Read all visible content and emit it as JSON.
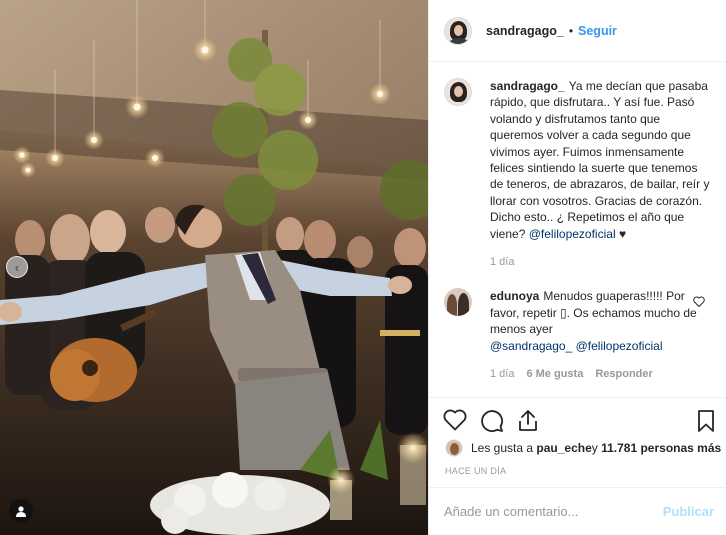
{
  "post": {
    "username": "sandragago_",
    "dot": "•",
    "follow_label": "Seguir"
  },
  "caption": {
    "username": "sandragago_",
    "text": "Ya me decían que pasaba rápido, que disfrutara.. Y así fue. Pasó volando y disfrutamos tanto que queremos volver a cada segundo que vivimos ayer. Fuimos inmensamente felices sintiendo la suerte que tenemos de teneros, de abrazaros, de bailar, reír y llorar con vosotros. Gracias de corazón. Dicho esto.. ¿ Repetimos el año que viene?",
    "mention": "@felilopezoficial",
    "heart": "♥",
    "age": "1 día"
  },
  "comment": {
    "username": "edunoya",
    "text": "Menudos guaperas!!!!! Por favor, repetir ▯. Os echamos mucho de menos ayer",
    "mention1": "@sandragago_",
    "mention2": "@felilopezoficial",
    "age": "1 día",
    "likes": "6 Me gusta",
    "reply": "Responder"
  },
  "actions": {
    "like_icon": "heart-icon",
    "comment_icon": "comment-icon",
    "share_icon": "share-icon",
    "save_icon": "bookmark-icon"
  },
  "likes_line": {
    "prefix": "Les gusta a ",
    "user": "pau_eche",
    "middle": " y ",
    "count": "11.781 personas más"
  },
  "timestamp": "HACE UN DÍA",
  "add_comment": {
    "placeholder": "Añade un comentario...",
    "publish": "Publicar"
  },
  "photo": {
    "prev_icon": "chevron-left-icon",
    "tag_icon": "user-tag-icon"
  },
  "colors": {
    "link_blue": "#3897f0",
    "mention_blue": "#003569",
    "publish_disabled": "#b2dffc",
    "muted": "#999999"
  }
}
